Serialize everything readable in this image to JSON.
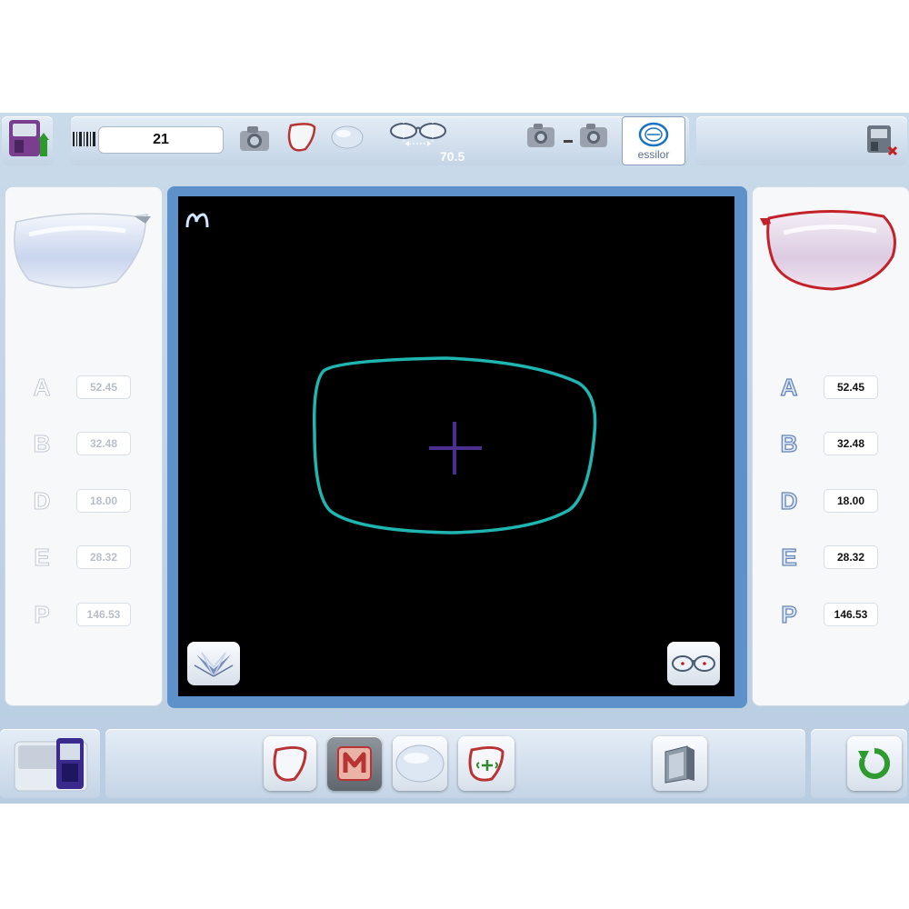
{
  "topbar": {
    "job_number": "21",
    "pd_value": "70.5",
    "brand_logo_text": "essilor"
  },
  "left_panel": {
    "measurements": [
      {
        "letter": "A",
        "value": "52.45"
      },
      {
        "letter": "B",
        "value": "32.48"
      },
      {
        "letter": "D",
        "value": "18.00"
      },
      {
        "letter": "E",
        "value": "28.32"
      },
      {
        "letter": "P",
        "value": "146.53"
      }
    ]
  },
  "right_panel": {
    "measurements": [
      {
        "letter": "A",
        "value": "52.45"
      },
      {
        "letter": "B",
        "value": "32.48"
      },
      {
        "letter": "D",
        "value": "18.00"
      },
      {
        "letter": "E",
        "value": "28.32"
      },
      {
        "letter": "P",
        "value": "146.53"
      }
    ]
  },
  "colors": {
    "shape_outline": "#1fb5b0",
    "crosshair": "#4b2f8f",
    "viewer_border": "#5e90c9",
    "right_lens_rim": "#c4222a"
  },
  "icons": {
    "top": [
      "machine-upload-icon",
      "barcode-icon",
      "camera-icon",
      "frame-icon",
      "lens-icon",
      "pd-glasses-icon",
      "camera-compare-icon",
      "essilor-logo",
      "exit-icon"
    ],
    "viewer": [
      "m-shape-icon",
      "open-book-icon",
      "glasses-centers-icon"
    ],
    "bottom": [
      "edger-machine-icon",
      "frame-button-icon",
      "m-button-icon",
      "lens-button-icon",
      "frame-center-icon",
      "export-icon",
      "refresh-icon"
    ]
  }
}
